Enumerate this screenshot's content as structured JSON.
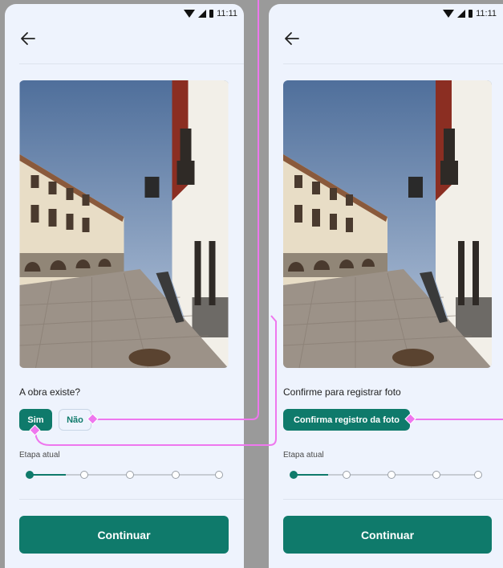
{
  "screens": [
    {
      "status": {
        "time": "11:11"
      },
      "question": "A obra existe?",
      "options": [
        {
          "label": "Sim"
        },
        {
          "label": "Não"
        }
      ],
      "stage_label": "Etapa atual",
      "stepper": {
        "total_steps": 5,
        "current_step": 1
      },
      "continue_label": "Continuar"
    },
    {
      "status": {
        "time": "11:11"
      },
      "question": "Confirme para registrar foto",
      "confirm_label": "Confirma registro da foto",
      "stage_label": "Etapa atual",
      "stepper": {
        "total_steps": 5,
        "current_step": 1
      },
      "continue_label": "Continuar"
    }
  ],
  "colors": {
    "accent": "#0f7a6b",
    "flow_connector": "#ee77ee",
    "screen_bg": "#eef3fd"
  },
  "icons": [
    "arrow-back-icon",
    "wifi-icon",
    "signal-icon",
    "battery-icon",
    "photo-street-scene"
  ]
}
